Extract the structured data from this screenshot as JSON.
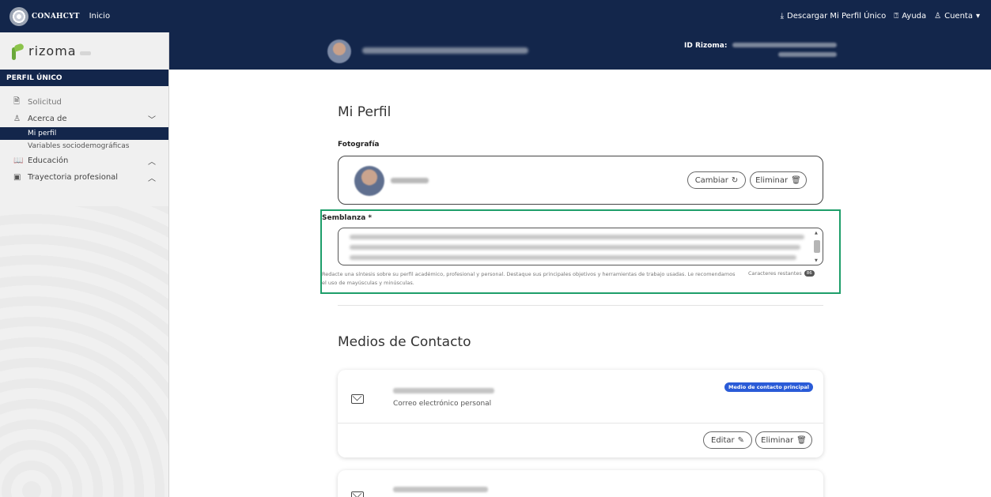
{
  "topbar": {
    "brand_name": "CONAHCYT",
    "home_link": "Inicio",
    "download_label": "Descargar Mi Perfil Único",
    "help_label": "Ayuda",
    "account_label": "Cuenta",
    "download_icon": "⤓",
    "help_icon": "⍰",
    "account_icon": "♙",
    "caret": "▾"
  },
  "sidebar": {
    "logo_text": "rizoma",
    "section_title": "PERFIL ÚNICO",
    "items": [
      {
        "label": "Solicitud",
        "icon": "🗎"
      },
      {
        "label": "Acerca de",
        "icon": "♙",
        "chevron": "﹀"
      },
      {
        "label": "Educación",
        "icon": "📖",
        "chevron": "︿"
      },
      {
        "label": "Trayectoria profesional",
        "icon": "▣",
        "chevron": "︿"
      }
    ],
    "subitems": [
      "Mi perfil",
      "Variables sociodemográficas"
    ]
  },
  "profile_band": {
    "id_label": "ID Rizoma:"
  },
  "main": {
    "page_title": "Mi Perfil",
    "photo_label": "Fotografía",
    "change_button": "Cambiar",
    "change_icon": "↻",
    "delete_button": "Eliminar",
    "delete_icon": "🗑",
    "bio_label": "Semblanza *",
    "bio_helper": "Redacte una síntesis sobre su perfil académico, profesional y personal. Destaque sus principales objetivos y herramientas de trabajo usadas. Le recomendamos el uso de mayúsculas y minúsculas.",
    "chars_label": "Caracteres restantes",
    "chars_count": "86",
    "contact_title": "Medios de Contacto",
    "contacts": [
      {
        "type": "Correo electrónico personal",
        "badge": "Medio de contacto principal",
        "edit": "Editar",
        "edit_icon": "✎",
        "delete": "Eliminar",
        "delete_icon": "🗑"
      }
    ]
  }
}
